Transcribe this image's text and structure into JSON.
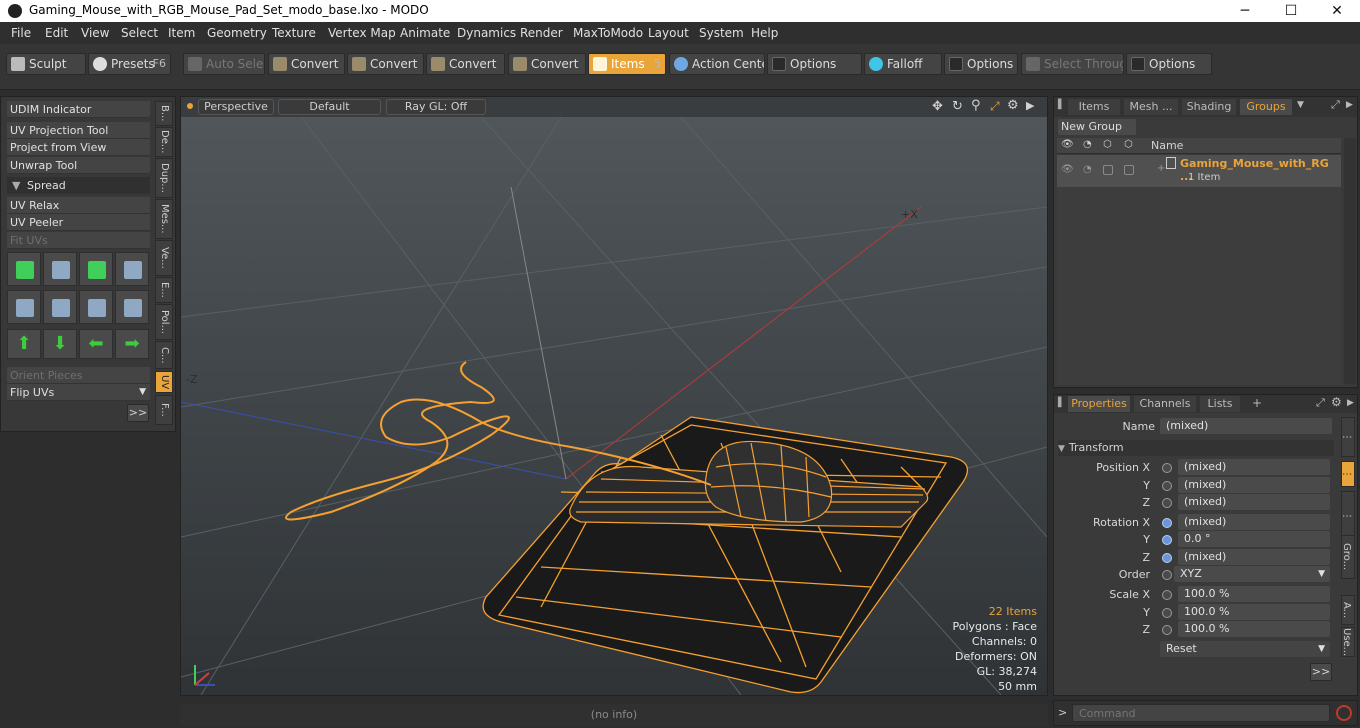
{
  "window": {
    "title": "Gaming_Mouse_with_RGB_Mouse_Pad_Set_modo_base.lxo - MODO",
    "minimize": "─",
    "maximize": "☐",
    "close": "✕"
  },
  "menu": [
    "File",
    "Edit",
    "View",
    "Select",
    "Item",
    "Geometry",
    "Texture",
    "Vertex Map",
    "Animate",
    "Dynamics",
    "Render",
    "MaxToModo",
    "Layout",
    "System",
    "Help"
  ],
  "toolbar": {
    "sculpt": "Sculpt",
    "presets": "Presets",
    "presets_key": "F6",
    "auto_select": "Auto Select",
    "convert1": "Convert",
    "convert2": "Convert",
    "convert3": "Convert",
    "convert4": "Convert",
    "items": "Items",
    "items_key": "5",
    "action_center": "Action Center",
    "options1": "Options",
    "falloff": "Falloff",
    "options2": "Options",
    "select_through": "Select Through",
    "options3": "Options"
  },
  "left_panel": {
    "udim": "UDIM Indicator",
    "uv_projection": "UV Projection Tool",
    "project_view": "Project from View",
    "unwrap": "Unwrap Tool",
    "spread": "Spread",
    "uv_relax": "UV Relax",
    "uv_peeler": "UV Peeler",
    "fit_uvs": "Fit UVs",
    "orient_pieces": "Orient Pieces",
    "flip_uvs": "Flip UVs",
    "more": ">>",
    "vtabs": [
      "B...",
      "De...",
      "Dup...",
      "Mes...",
      "Ve...",
      "E...",
      "Pol...",
      "C...",
      "UV",
      "F..."
    ]
  },
  "viewport": {
    "perspective": "Perspective",
    "default": "Default",
    "raygl": "Ray GL: Off",
    "axis_x": "+X",
    "axis_z": "-Z",
    "stats": {
      "items": "22 Items",
      "polygons": "Polygons : Face",
      "channels": "Channels: 0",
      "deformers": "Deformers: ON",
      "gl": "GL: 38,274",
      "scale": "50 mm"
    },
    "status": "(no info)"
  },
  "groups_panel": {
    "tabs": [
      "Items",
      "Mesh ...",
      "Shading",
      "Groups"
    ],
    "new_group": "New Group",
    "col_name": "Name",
    "row_name": "Gaming_Mouse_with_RG ...",
    "row_sub": "1 Item"
  },
  "properties_panel": {
    "tabs": [
      "Properties",
      "Channels",
      "Lists"
    ],
    "add_tab": "+",
    "name_label": "Name",
    "name_value": "(mixed)",
    "transform": "Transform",
    "position_x_label": "Position X",
    "position_x": "(mixed)",
    "position_y_label": "Y",
    "position_y": "(mixed)",
    "position_z_label": "Z",
    "position_z": "(mixed)",
    "rotation_x_label": "Rotation X",
    "rotation_x": "(mixed)",
    "rotation_y_label": "Y",
    "rotation_y": "0.0 °",
    "rotation_z_label": "Z",
    "rotation_z": "(mixed)",
    "order_label": "Order",
    "order_value": "XYZ",
    "scale_x_label": "Scale X",
    "scale_x": "100.0 %",
    "scale_y_label": "Y",
    "scale_y": "100.0 %",
    "scale_z_label": "Z",
    "scale_z": "100.0 %",
    "reset": "Reset",
    "more": ">>",
    "side_tabs": [
      "Gro...",
      "A...",
      "Use..."
    ]
  },
  "command": {
    "prompt": ">",
    "placeholder": "Command"
  },
  "colors": {
    "accent": "#e9a43a",
    "wire": "#f5a030",
    "viewport_bg": "#4a4f52"
  }
}
